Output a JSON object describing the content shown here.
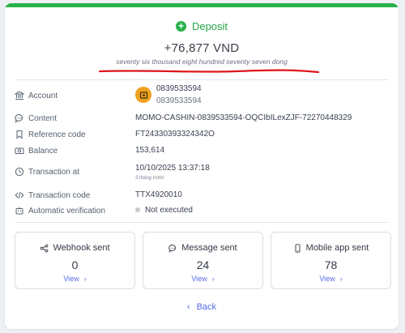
{
  "header": {
    "title": "Deposit",
    "amount": "+76,877 VND",
    "amount_words": "seventy six thousand eight hundred seventy seven dong"
  },
  "details": {
    "account": {
      "label": "Account",
      "name": "0839533594",
      "number": "0839533594"
    },
    "content": {
      "label": "Content",
      "value": "MOMO-CASHIN-0839533594-OQCIbILexZJF-72270448329"
    },
    "reference": {
      "label": "Reference code",
      "value": "FT24330393324342O"
    },
    "balance": {
      "label": "Balance",
      "value": "153,614"
    },
    "transaction_at": {
      "label": "Transaction at",
      "value": "10/10/2025 13:37:18",
      "relative": "3 tháng trước"
    },
    "transaction_code": {
      "label": "Transaction code",
      "value": "TTX4920010"
    },
    "verification": {
      "label": "Automatic verification",
      "value": "Not executed"
    }
  },
  "stats": [
    {
      "title": "Webhook sent",
      "count": "0",
      "link": "View",
      "icon": "share-icon"
    },
    {
      "title": "Message sent",
      "count": "24",
      "link": "View",
      "icon": "chat-icon"
    },
    {
      "title": "Mobile app sent",
      "count": "78",
      "link": "View",
      "icon": "phone-icon"
    }
  ],
  "footer": {
    "back_label": "Back"
  },
  "colors": {
    "accent_green": "#27b24a",
    "link_blue": "#5468e6",
    "annotation_red": "#e0151b"
  }
}
